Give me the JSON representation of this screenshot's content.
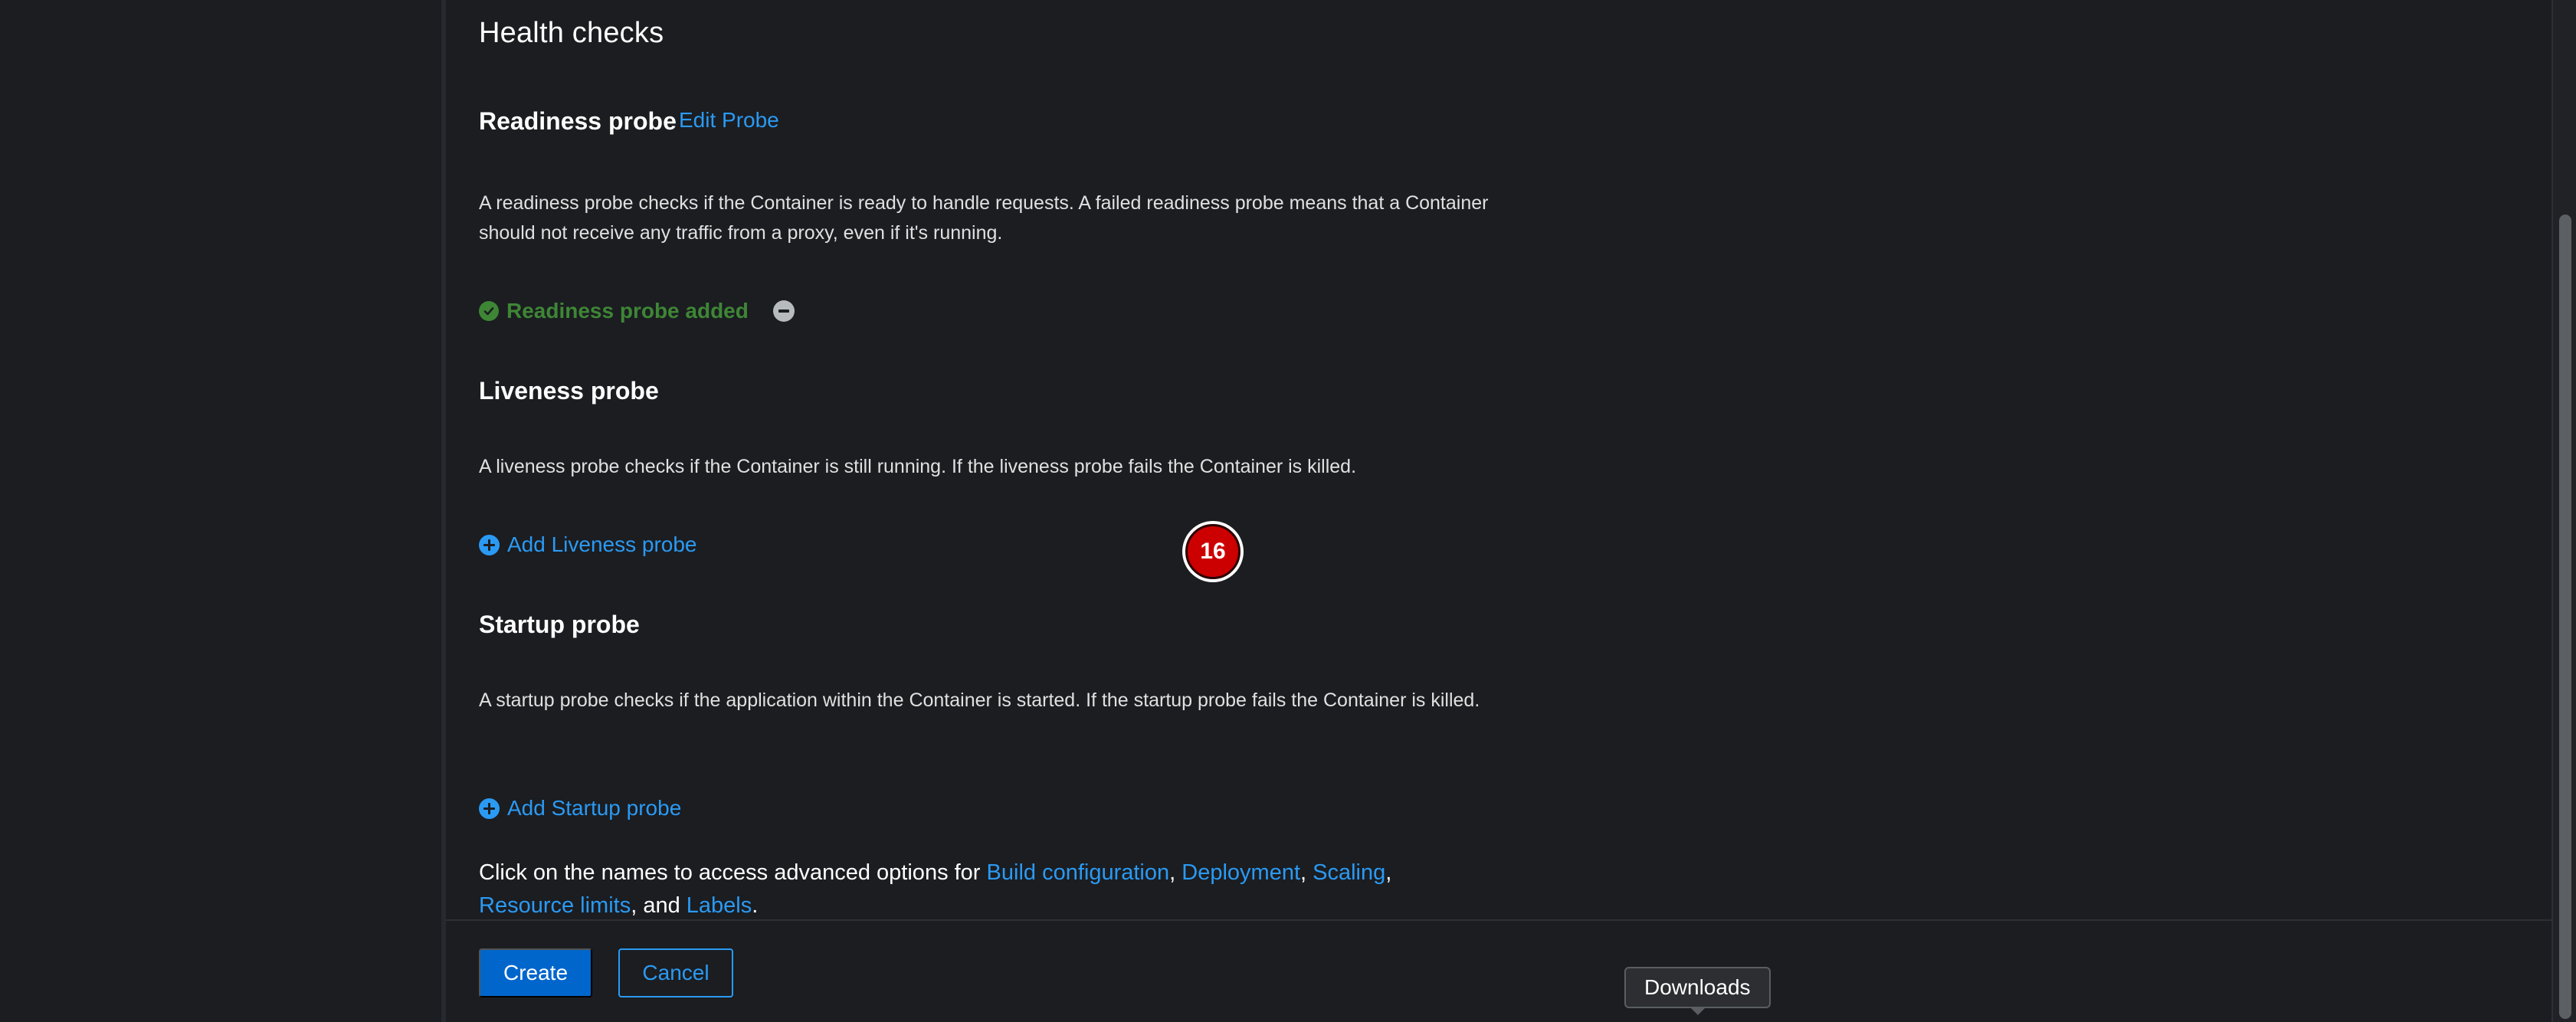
{
  "health_checks": {
    "title": "Health checks",
    "readiness": {
      "title": "Readiness probe",
      "edit_link": "Edit Probe",
      "description": "A readiness probe checks if the Container is ready to handle requests. A failed readiness probe means that a Container should not receive any traffic from a proxy, even if it's running.",
      "status": "Readiness probe added",
      "status_color": "#3e8635"
    },
    "liveness": {
      "title": "Liveness probe",
      "description": "A liveness probe checks if the Container is still running. If the liveness probe fails the Container is killed.",
      "add_label": "Add Liveness probe",
      "badge": "16"
    },
    "startup": {
      "title": "Startup probe",
      "description": "A startup probe checks if the application within the Container is started. If the startup probe fails the Container is killed.",
      "add_label": "Add Startup probe"
    }
  },
  "advanced": {
    "prefix": "Click on the names to access advanced options for ",
    "build_configuration": "Build configuration",
    "deployment": "Deployment",
    "scaling": "Scaling",
    "resource_limits": "Resource limits",
    "labels": "Labels",
    "sep_comma": ",",
    "sep_and": ", and ",
    "suffix": "."
  },
  "footer": {
    "create_label": "Create",
    "cancel_label": "Cancel"
  },
  "tooltip": {
    "text": "Downloads"
  },
  "colors": {
    "link": "#2b9af3",
    "primary": "#0066cc",
    "success": "#3e8635",
    "badge": "#cc0000"
  }
}
